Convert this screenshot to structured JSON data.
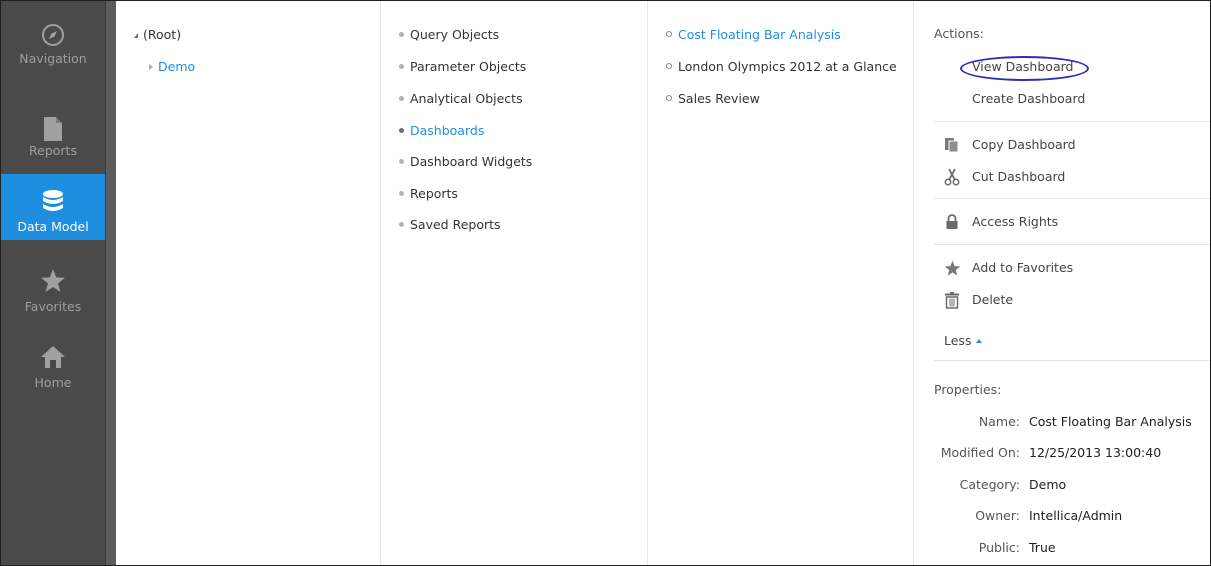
{
  "sidebar": {
    "items": [
      {
        "label": "Navigation",
        "icon": "compass-icon",
        "active": false
      },
      {
        "label": "Reports",
        "icon": "document-icon",
        "active": false
      },
      {
        "label": "Data Model",
        "icon": "database-icon",
        "active": true
      },
      {
        "label": "Favorites",
        "icon": "star-icon",
        "active": false
      },
      {
        "label": "Home",
        "icon": "home-icon",
        "active": false
      }
    ]
  },
  "tree": {
    "root": "(Root)",
    "child": "Demo"
  },
  "object_types": [
    "Query Objects",
    "Parameter Objects",
    "Analytical Objects",
    "Dashboards",
    "Dashboard Widgets",
    "Reports",
    "Saved Reports"
  ],
  "dashboards": [
    "Cost Floating Bar Analysis",
    "London Olympics 2012 at a Glance",
    "Sales Review"
  ],
  "actions": {
    "title": "Actions:",
    "view": "View Dashboard",
    "create": "Create Dashboard",
    "copy": "Copy Dashboard",
    "cut": "Cut Dashboard",
    "access": "Access Rights",
    "favorites": "Add to Favorites",
    "delete": "Delete",
    "less": "Less"
  },
  "properties": {
    "title": "Properties:",
    "rows": [
      {
        "key": "Name:",
        "value": "Cost Floating Bar Analysis"
      },
      {
        "key": "Modified On:",
        "value": "12/25/2013 13:00:40"
      },
      {
        "key": "Category:",
        "value": "Demo"
      },
      {
        "key": "Owner:",
        "value": "Intellica/Admin"
      },
      {
        "key": "Public:",
        "value": "True"
      }
    ]
  },
  "colors": {
    "accent": "#1e8fe0",
    "sidebar": "#4a4a4a",
    "highlight_oval": "#2b2fb8"
  }
}
